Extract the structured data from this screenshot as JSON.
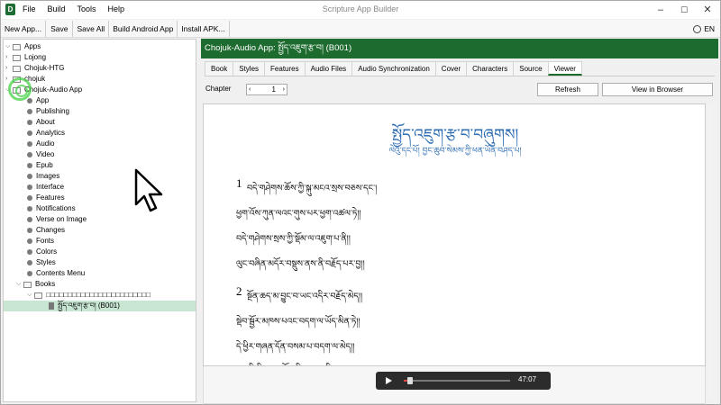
{
  "window": {
    "title": "Scripture App Builder",
    "app_icon_glyph": "D",
    "menu": [
      "File",
      "Build",
      "Tools",
      "Help"
    ],
    "controls": {
      "minimize": "–",
      "maximize": "☐",
      "close": "✕"
    }
  },
  "toolbar": {
    "buttons": [
      "New App...",
      "Save",
      "Save All",
      "Build Android App",
      "Install APK..."
    ],
    "language": "EN"
  },
  "tree": {
    "root": "Apps",
    "apps": [
      "Lojong",
      "Chojuk-HTG",
      "chojuk"
    ],
    "open_app": "Chojuk-Audio App",
    "items": [
      "App",
      "Publishing",
      "About",
      "Analytics",
      "Audio",
      "Video",
      "Epub",
      "Images",
      "Interface",
      "Features",
      "Notifications",
      "Verse on Image",
      "Changes",
      "Fonts",
      "Colors",
      "Styles",
      "Contents Menu"
    ],
    "books_label": "Books",
    "collection": "□□□□□□□□□□□□□□□□□□□□□□□□",
    "selected_book": "སྤྱོད་འཇུག་རྩ་བ། (B001)"
  },
  "header": {
    "title": "Chojuk-Audio App: སྤྱོད་འཇུག་རྩ་བ། (B001)"
  },
  "tabs": {
    "items": [
      "Book",
      "Styles",
      "Features",
      "Audio Files",
      "Audio Synchronization",
      "Cover",
      "Characters",
      "Source",
      "Viewer"
    ],
    "active": "Viewer"
  },
  "controls": {
    "chapter_label": "Chapter",
    "chapter_value": "1",
    "refresh_label": "Refresh",
    "view_browser_label": "View in Browser"
  },
  "viewer": {
    "title": "སྤྱོད་འཇུག་རྩ་བ་བཞུགས།",
    "subtitle": "ལེའུ་དང་པོ། བྱང་ཆུབ་སེམས་ཀྱི་ཕན་ཡོན་བཤད་པ།",
    "verses": [
      {
        "number": "1",
        "lines": [
          "བདེ་གཤེགས་ཆོས་ཀྱི་སྐུ་མངའ་སྲས་བཅས་དང༌།",
          "ཕྱག་འོས་ཀུན་ལའང་གུས་པར་ཕྱག་འཚལ་ཏེ།།",
          "བདེ་གཤེགས་སྲས་ཀྱི་སྡོམ་ལ་འཇུག་པ་ནི།།",
          "ལུང་བཞིན་མདོར་བསྡུས་ནས་ནི་བརྗོད་པར་བྱ།།"
        ]
      },
      {
        "number": "2",
        "lines": [
          "སྔོན་ཆད་མ་བྱུང་བ་ཡང་འདིར་བརྗོད་མེད།།",
          "སྡེབ་སྦྱོར་མཁས་པའང་བདག་ལ་ཡོད་མིན་ཏེ།།",
          "དེ་ཕྱིར་གཞན་དོན་བསམ་པ་བདག་ལ་མེད།།",
          "རང་གི་ཡིད་ལ་བསྒོམ་ཕྱིར་ངས་འདི་བརྩམས།།"
        ]
      }
    ]
  },
  "player": {
    "time": "47:07",
    "progress": 0.03
  },
  "colors": {
    "header_green": "#1d6b2f",
    "tibetan_blue": "#2e6db3",
    "selection_green": "#c9e6d2",
    "player_progress_red": "#e04848"
  }
}
